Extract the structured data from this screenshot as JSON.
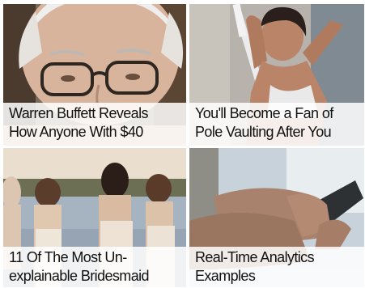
{
  "tiles": [
    {
      "line1": "Warren Buffett Reveals",
      "line2": "How Anyone With $40",
      "image": "elderly-man-glasses-photo"
    },
    {
      "line1": "You'll Become a Fan of",
      "line2": "Pole Vaulting After You",
      "image": "athlete-pole-vault-photo"
    },
    {
      "line1": "11 Of The Most Un-",
      "line2": "explainable Bridesmaid",
      "image": "bridesmaids-lake-photo"
    },
    {
      "line1": "Real-Time Analytics",
      "line2": "Examples",
      "image": "hands-smartphone-photo"
    }
  ]
}
